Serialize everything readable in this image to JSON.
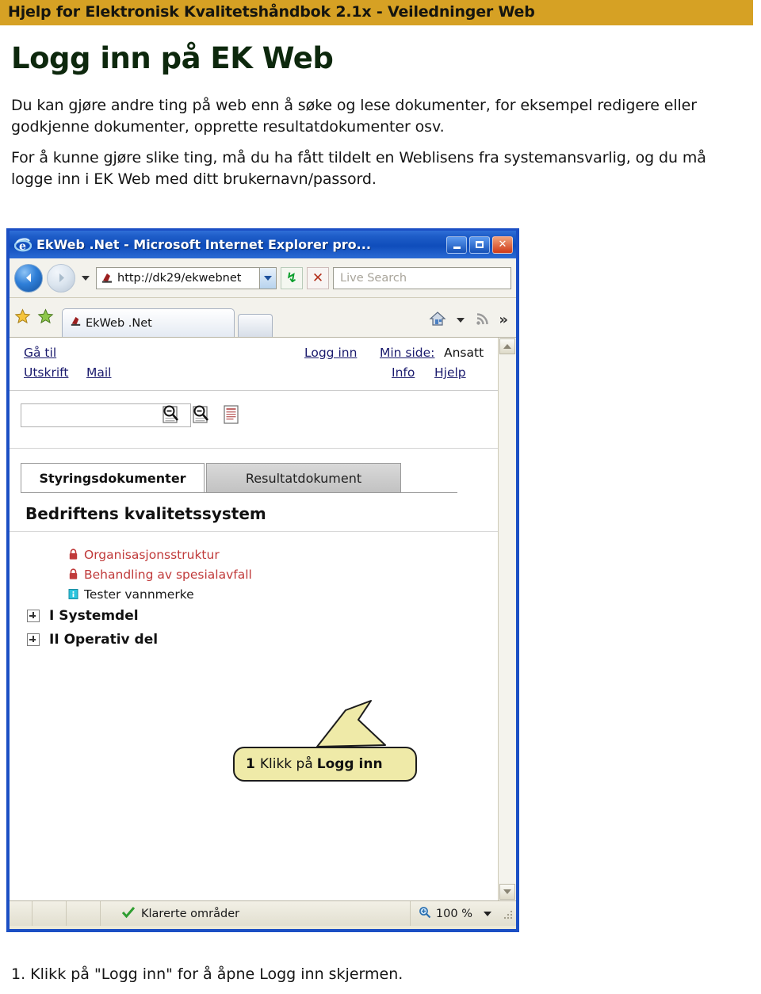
{
  "header": {
    "title": "Hjelp for Elektronisk Kvalitetshåndbok 2.1x - Veiledninger Web",
    "band_color": "#d6a124"
  },
  "page": {
    "heading": "Logg inn på EK Web",
    "heading_color": "#0d280d",
    "paragraph_1": "Du kan gjøre andre ting på web enn å søke og lese dokumenter, for eksempel redigere eller godkjenne dokumenter, opprette resultatdokumenter osv.",
    "paragraph_2": "For å kunne gjøre slike ting, må du ha fått tildelt en Weblisens fra systemansvarlig, og du må logge inn i EK Web med ditt brukernavn/passord.",
    "caption": "1. Klikk på \"Logg inn\" for å åpne Logg inn skjermen."
  },
  "browser": {
    "titlebar": {
      "text": "EkWeb .Net - Microsoft Internet Explorer pro...",
      "minimize_label": "Minimer",
      "maximize_label": "Maksimer",
      "close_label": "Lukk"
    },
    "nav": {
      "back_label": "Tilbake",
      "forward_label": "Fram",
      "history_label": "Nylige sider",
      "address_value": "http://dk29/ekwebnet",
      "refresh_glyph": "↯",
      "stop_glyph": "✕",
      "search_placeholder": "Live Search"
    },
    "tabs": {
      "favorites_label": "Favoritter",
      "add_favorite_label": "Legg til i favoritter",
      "active_tab_label": "EkWeb .Net",
      "new_tab_label": "Ny fane",
      "home_label": "Hjem",
      "feeds_label": "Feeds",
      "overflow_glyph": "»"
    },
    "status": {
      "zone_text": "Klarerte områder",
      "zoom_text": "100 %"
    }
  },
  "webpage": {
    "links_left": [
      {
        "label": "Gå til"
      },
      {
        "label": "Utskrift"
      },
      {
        "label": "Mail"
      }
    ],
    "links_right": [
      {
        "label": "Logg inn"
      },
      {
        "label": "Min side:"
      },
      {
        "label": "Ansatt"
      },
      {
        "label": "Info"
      },
      {
        "label": "Hjelp"
      }
    ],
    "search": {
      "value": "",
      "icon_1": "search-document-icon",
      "icon_2": "search-zoom-icon",
      "icon_3": "document-list-icon"
    },
    "tabs": [
      {
        "label": "Styringsdokumenter",
        "active": true
      },
      {
        "label": "Resultatdokument",
        "active": false
      }
    ],
    "section_title": "Bedriftens kvalitetssystem",
    "tree": [
      {
        "label": "Organisasjonsstruktur",
        "icon": "lock-icon",
        "level": "child",
        "color": "#c03a3a"
      },
      {
        "label": "Behandling av spesialavfall",
        "icon": "lock-icon",
        "level": "child",
        "color": "#c03a3a"
      },
      {
        "label": "Tester vannmerke",
        "icon": "info-doc-icon",
        "level": "child",
        "color": "#1b1b1b"
      },
      {
        "label": "I Systemdel",
        "icon": "expand-plus-icon",
        "level": "top",
        "color": "#111111"
      },
      {
        "label": "II Operativ del",
        "icon": "expand-plus-icon",
        "level": "top",
        "color": "#111111"
      }
    ]
  },
  "callout": {
    "number": "1",
    "text": "Klikk på",
    "emphasis": "Logg inn",
    "fill_color": "#efeaa8"
  }
}
